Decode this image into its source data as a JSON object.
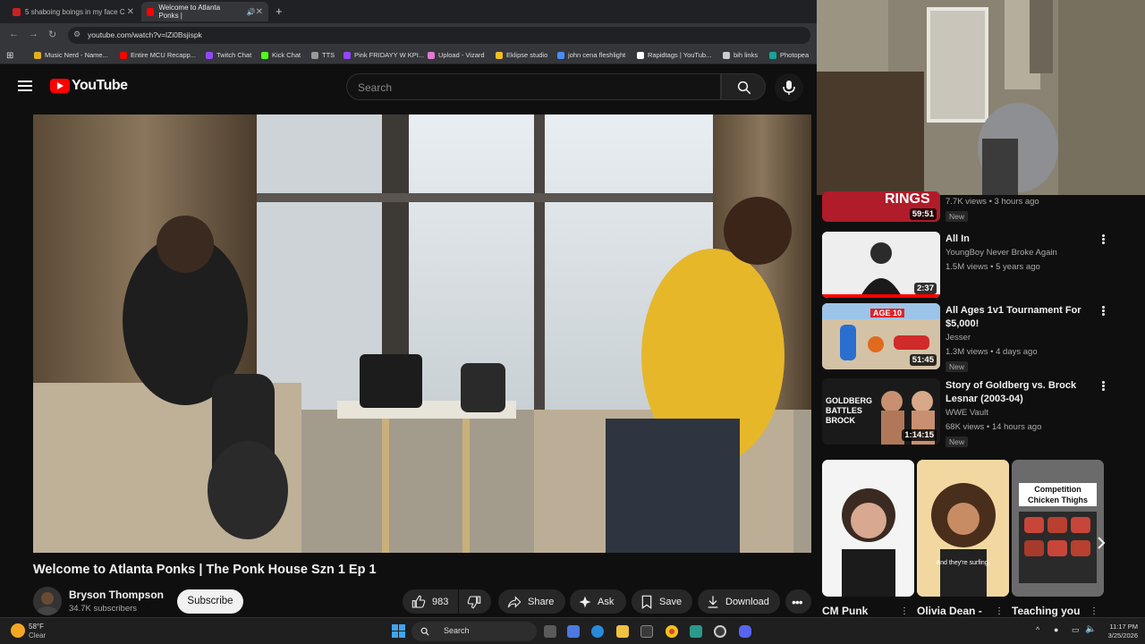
{
  "browser": {
    "tabs": [
      {
        "title": "5 shaboing boings in my face C",
        "color": "#cc1f1f"
      },
      {
        "title": "Welcome to Atlanta Ponks |",
        "color": "#ff0000"
      }
    ],
    "new_tab_label": "+",
    "url": "youtube.com/watch?v=lZi0Bsjispk",
    "bookmarks": [
      {
        "label": "Music Nerd - Name...",
        "color": "#e0b020"
      },
      {
        "label": "Entire MCU Recapp...",
        "color": "#ff0000"
      },
      {
        "label": "Twitch Chat",
        "color": "#9147ff"
      },
      {
        "label": "Kick Chat",
        "color": "#53fc18"
      },
      {
        "label": "TTS",
        "color": "#999999"
      },
      {
        "label": "Pink FRIDAYY W KPI...",
        "color": "#9147ff"
      },
      {
        "label": "Upload - Vizard",
        "color": "#e07ad0"
      },
      {
        "label": "Eklipse studio",
        "color": "#f0c020"
      },
      {
        "label": "john cena fleshlight",
        "color": "#4a8cff"
      },
      {
        "label": "Rapidtags | YouTub...",
        "color": "#ffffff"
      },
      {
        "label": "bih links",
        "color": "#cccccc"
      },
      {
        "label": "Photopea",
        "color": "#18a497"
      }
    ]
  },
  "youtube": {
    "logo_text": "YouTube",
    "search_placeholder": "Search",
    "video": {
      "title": "Welcome to Atlanta Ponks | The Ponk House Szn 1 Ep 1",
      "channel": "Bryson Thompson",
      "subscribers": "34.7K subscribers",
      "subscribe_label": "Subscribe",
      "likes": "983",
      "share_label": "Share",
      "ask_label": "Ask",
      "save_label": "Save",
      "download_label": "Download"
    },
    "recommendations": [
      {
        "title": "",
        "channel": "",
        "meta": "7.7K views • 3 hours ago",
        "duration": "59:51",
        "badge": "New",
        "thumb_text": "RINGS"
      },
      {
        "title": "All In",
        "channel": "YoungBoy Never Broke Again",
        "meta": "1.5M views • 5 years ago",
        "duration": "2:37",
        "badge": "",
        "thumb_text": ""
      },
      {
        "title": "All Ages 1v1 Tournament For $5,000!",
        "channel": "Jesser",
        "meta": "1.3M views • 4 days ago",
        "duration": "51:45",
        "badge": "New",
        "thumb_text": "AGE 10"
      },
      {
        "title": "Story of Goldberg vs. Brock Lesnar (2003-04)",
        "channel": "WWE Vault",
        "meta": "68K views • 14 hours ago",
        "duration": "1:14:15",
        "badge": "New",
        "thumb_text": "GOLDBERG BATTLES BROCK"
      }
    ],
    "shorts": [
      {
        "title": "CM Punk",
        "overlay": ""
      },
      {
        "title": "Olivia Dean -",
        "overlay": "And they're surfing,"
      },
      {
        "title": "Teaching you",
        "overlay": "Competition Chicken Thighs"
      }
    ]
  },
  "taskbar": {
    "weather_temp": "58°F",
    "weather_desc": "Clear",
    "search_label": "Search",
    "time": "11:17 PM",
    "date": "3/25/2026"
  }
}
